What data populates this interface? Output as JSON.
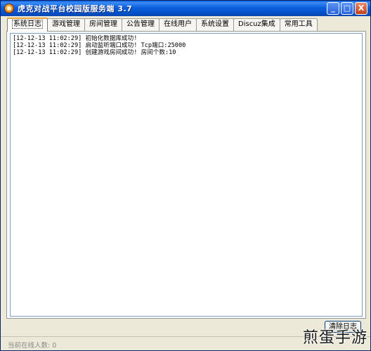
{
  "window": {
    "title": "虎克对战平台校园版服务端 3.7",
    "minimize_label": "_",
    "maximize_label": "□",
    "close_label": "X"
  },
  "tabs": [
    {
      "label": "系统日志",
      "active": true
    },
    {
      "label": "游戏管理",
      "active": false
    },
    {
      "label": "房间管理",
      "active": false
    },
    {
      "label": "公告管理",
      "active": false
    },
    {
      "label": "在线用户",
      "active": false
    },
    {
      "label": "系统设置",
      "active": false
    },
    {
      "label": "Discuz集成",
      "active": false
    },
    {
      "label": "常用工具",
      "active": false
    }
  ],
  "log": {
    "lines": [
      "[12-12-13 11:02:29] 初始化数据库成功!",
      "[12-12-13 11:02:29] 启动监听端口成功! Tcp端口:25000",
      "[12-12-13 11:02:29] 创建游戏房间成功! 房间个数:10"
    ]
  },
  "buttons": {
    "clear_log": "清除日志"
  },
  "status": {
    "online_count": "当前在线人数: 0"
  },
  "watermark": "煎蛋手游"
}
